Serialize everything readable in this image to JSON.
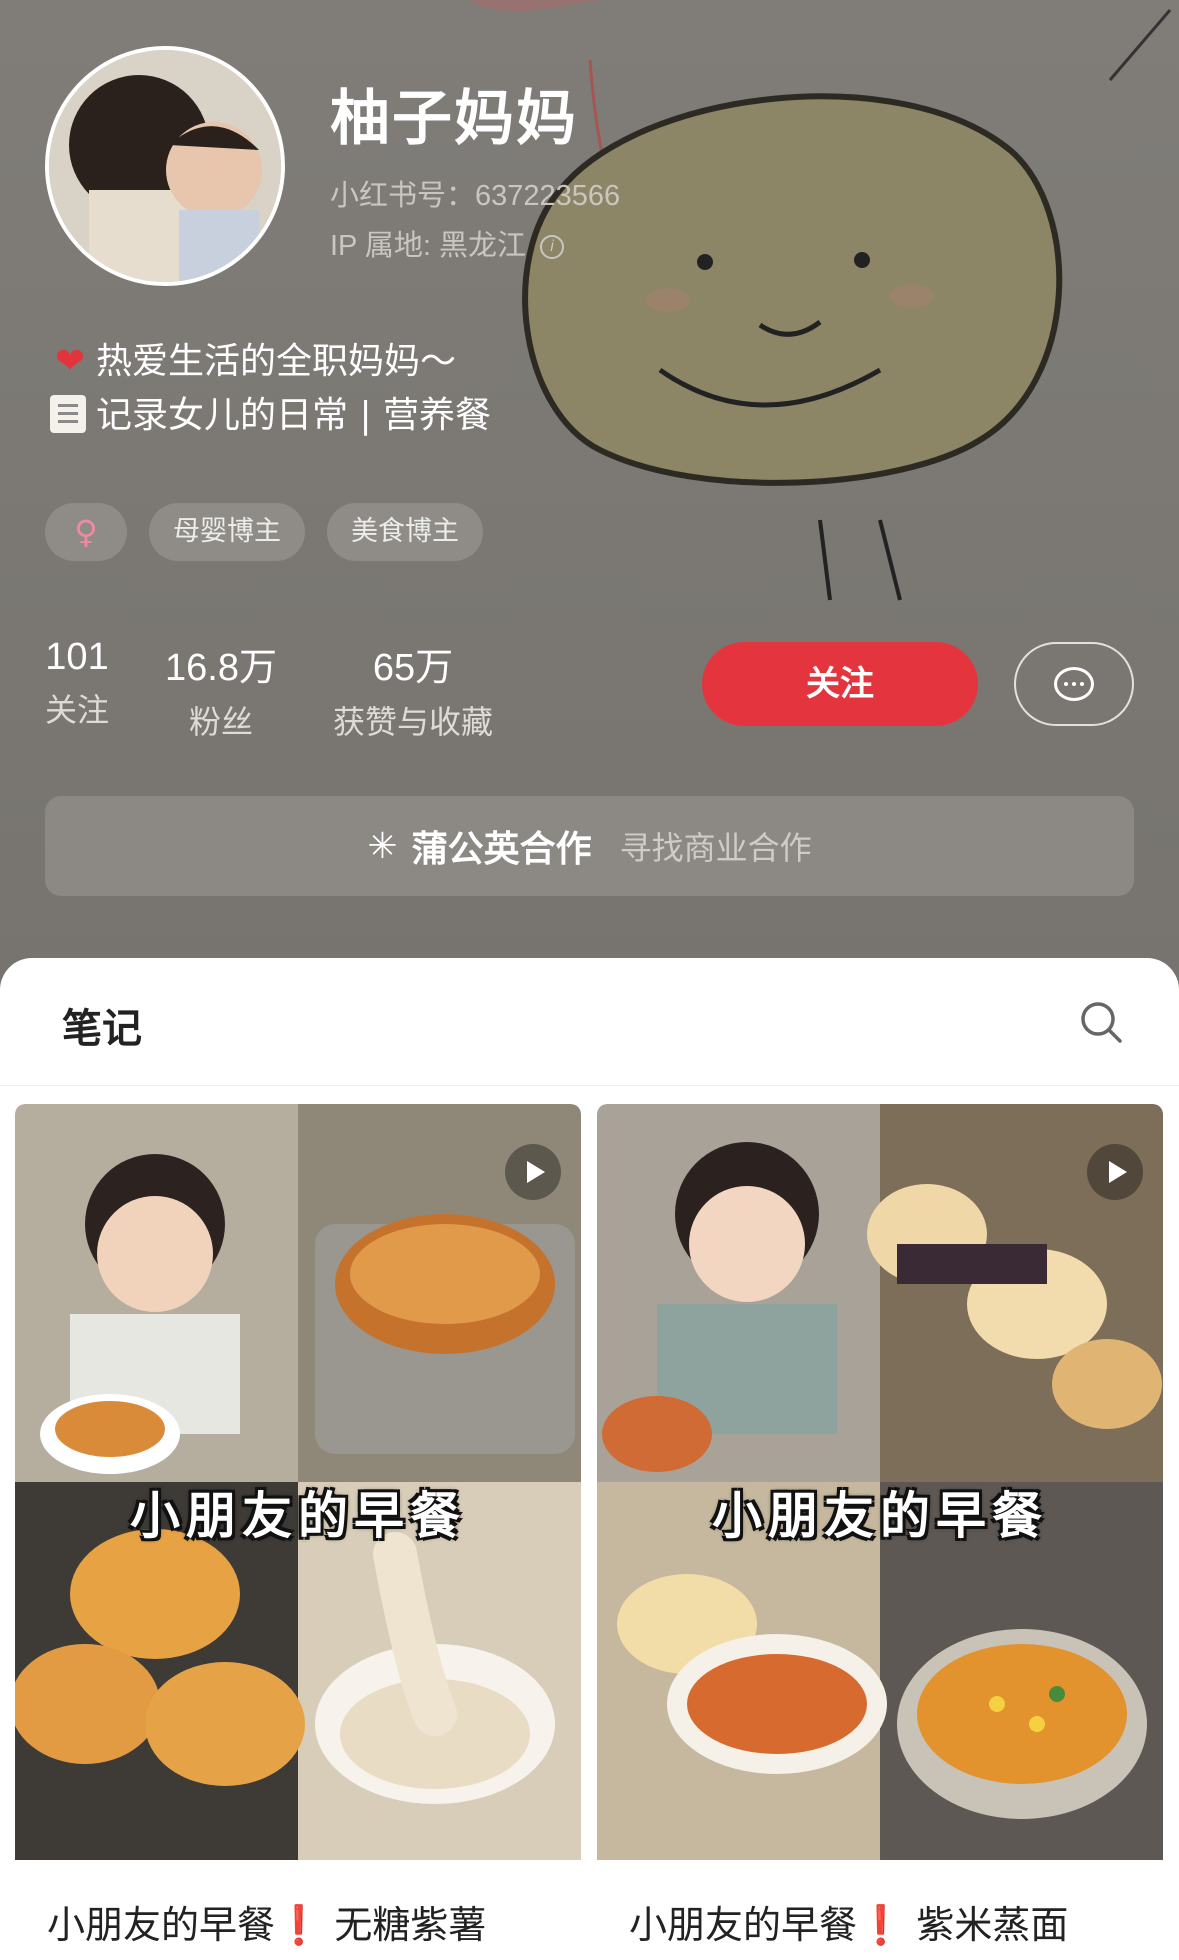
{
  "profile": {
    "nickname": "柚子妈妈",
    "redbook_id": "小红书号：637223566",
    "ip_location": "IP 属地: 黑龙江",
    "bio_line1": "热爱生活的全职妈妈～",
    "bio_line2": "记录女儿的日常 | 营养餐",
    "tags": [
      "♀",
      "母婴博主",
      "美食博主"
    ],
    "stats": [
      {
        "num": "101",
        "label": "关注"
      },
      {
        "num": "16.8万",
        "label": "粉丝"
      },
      {
        "num": "65万",
        "label": "获赞与收藏"
      }
    ],
    "follow_label": "关注",
    "collab_title": "蒲公英合作",
    "collab_sub": "寻找商业合作"
  },
  "tabs": {
    "notes": "笔记"
  },
  "notes": [
    {
      "overlay": "小朋友的早餐",
      "title_prefix": "小朋友的早餐",
      "title_mark": "❗",
      "title_suffix": " 无糖紫薯"
    },
    {
      "overlay": "小朋友的早餐",
      "title_prefix": "小朋友的早餐",
      "title_mark": "❗",
      "title_suffix": " 紫米蒸面"
    }
  ],
  "colors": {
    "accent": "#e4353f",
    "header_bg": "#7b7874"
  },
  "icons": [
    "info-icon",
    "heart-icon",
    "memo-icon",
    "female-icon",
    "message-icon",
    "dandelion-icon",
    "search-icon",
    "play-icon"
  ]
}
